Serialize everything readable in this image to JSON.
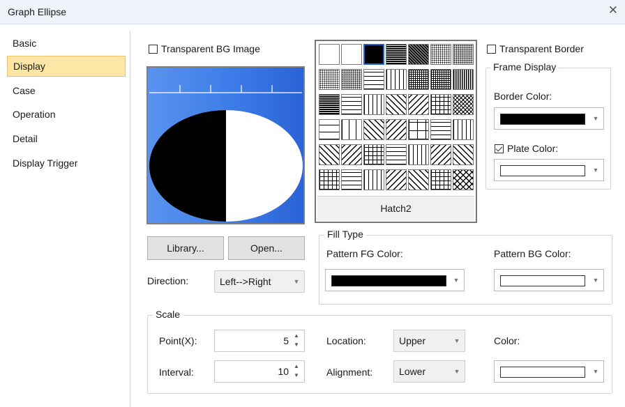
{
  "window": {
    "title": "Graph Ellipse",
    "close_glyph": "✕"
  },
  "sidebar": {
    "items": [
      {
        "label": "Basic",
        "selected": false
      },
      {
        "label": "Display",
        "selected": true
      },
      {
        "label": "Case",
        "selected": false
      },
      {
        "label": "Operation",
        "selected": false
      },
      {
        "label": "Detail",
        "selected": false
      },
      {
        "label": "Display Trigger",
        "selected": false
      }
    ]
  },
  "preview": {
    "transparent_bg_label": "Transparent BG Image",
    "transparent_bg_checked": false,
    "library_button": "Library...",
    "open_button": "Open...",
    "direction_label": "Direction:",
    "direction_value": "Left-->Right",
    "fill_fraction": 0.5,
    "ellipse_fill_color": "#000000",
    "background_color": "#3a78e6"
  },
  "hatch": {
    "selected_name": "Hatch2",
    "selected_index": 2,
    "pattern_count": 42
  },
  "frame": {
    "transparent_border_label": "Transparent Border",
    "transparent_border_checked": false,
    "group_title": "Frame Display",
    "border_color_label": "Border Color:",
    "border_color": "#000000",
    "plate_color_label": "Plate Color:",
    "plate_color_checked": true,
    "plate_color": "#ffffff"
  },
  "fill_type": {
    "group_title": "Fill Type",
    "fg_label": "Pattern FG Color:",
    "fg_color": "#000000",
    "bg_label": "Pattern BG Color:",
    "bg_color": "#ffffff"
  },
  "scale": {
    "group_title": "Scale",
    "point_label": "Point(X):",
    "point_value": "5",
    "interval_label": "Interval:",
    "interval_value": "10",
    "location_label": "Location:",
    "location_value": "Upper",
    "alignment_label": "Alignment:",
    "alignment_value": "Lower",
    "color_label": "Color:",
    "color": "#ffffff"
  },
  "icons": {
    "close": "close-icon",
    "dropdown": "chevron-down-icon",
    "spin_up": "spin-up-icon",
    "spin_down": "spin-down-icon"
  }
}
